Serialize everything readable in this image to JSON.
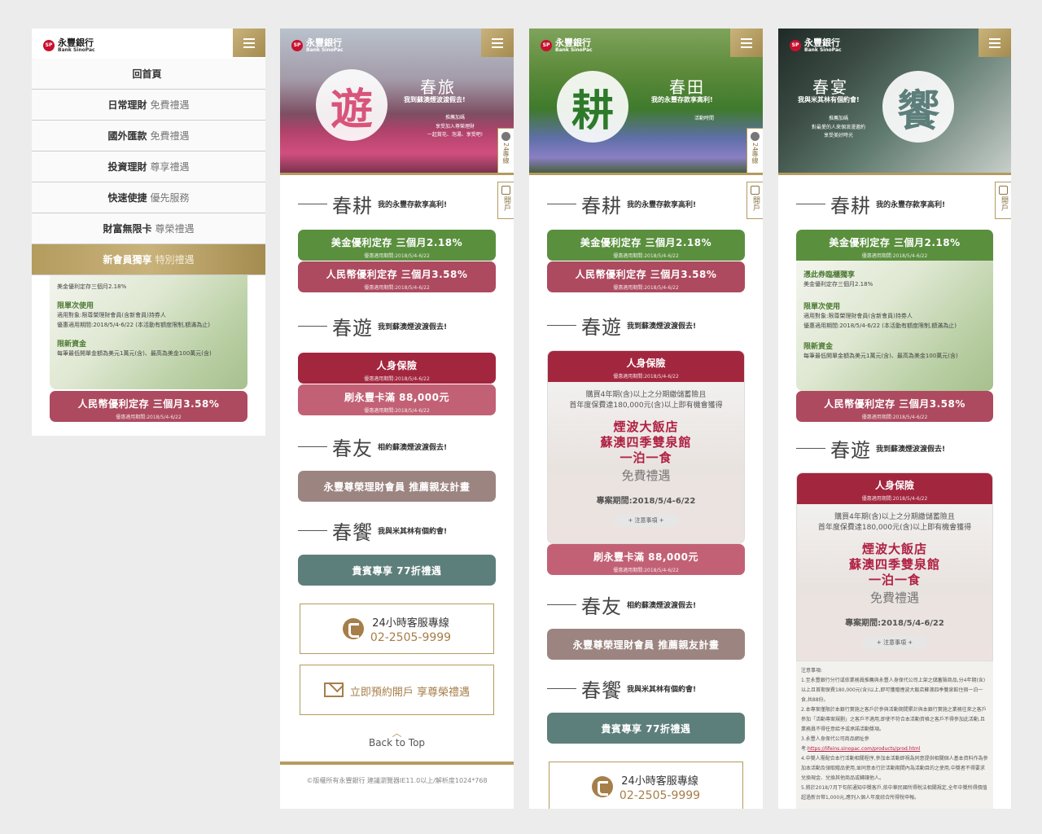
{
  "brand": {
    "cn": "永豐銀行",
    "en": "Bank SinoPac"
  },
  "menu": {
    "items": [
      {
        "bold": "回首頁",
        "light": ""
      },
      {
        "bold": "日常理財",
        "light": "免費禮遇"
      },
      {
        "bold": "國外匯款",
        "light": "免費禮遇"
      },
      {
        "bold": "投資理財",
        "light": "尊享禮遇"
      },
      {
        "bold": "快速使捷",
        "light": "優先服務"
      },
      {
        "bold": "財富無限卡",
        "light": "尊榮禮遇"
      },
      {
        "bold": "新會員獨享",
        "light": "特別禮遇"
      }
    ]
  },
  "side": {
    "hotline": "24專線",
    "open": "開戶"
  },
  "heroes": {
    "p2": {
      "char": "遊",
      "title": "春旅",
      "sub": "我到蘇澳煙波渡假去!",
      "small1": "推薦加碼",
      "small2": "享受加入尊榮理財\n一起賞花、泡湯、享受吧!"
    },
    "p3": {
      "char": "耕",
      "title": "春田",
      "sub": "我的永豐存款享高利!",
      "small1": "活動時間",
      "small2": ""
    },
    "p4": {
      "char": "饗",
      "title": "春宴",
      "sub": "我與米其林有個約會!",
      "small1": "推薦加碼",
      "small2": "對最愛的人來個浪漫邀約\n享受美好時光"
    }
  },
  "sections": {
    "geng": {
      "t": "春耕",
      "d": "我的永豐存款享高利!"
    },
    "you": {
      "t": "春遊",
      "d": "我到蘇澳煙波渡假去!"
    },
    "friend": {
      "t": "春友",
      "d": "相約蘇澳煙波渡假去!"
    },
    "feast": {
      "t": "春饗",
      "d": "我與米其林有個約會!"
    }
  },
  "offers": {
    "usd": {
      "m": "美金優利定存 三個月2.18%",
      "s": "優惠適用期間:2018/5/4-6/22"
    },
    "rmb": {
      "m": "人民幣優利定存 三個月3.58%",
      "s": "優惠適用期間:2018/5/4-6/22"
    },
    "life": {
      "m": "人身保險",
      "s": "優惠適用期間:2018/5/4-6/22"
    },
    "card": {
      "m": "刷永豐卡滿 88,000元",
      "s": "優惠適用期間:2018/5/4-6/22"
    },
    "member": {
      "m": "永豐尊榮理財會員 推薦親友計畫"
    },
    "vip": {
      "m": "貴賓專享 77折禮遇"
    }
  },
  "usd_detail": {
    "h1": "憑此券臨櫃獨享",
    "x1": "美金優利定存三個月2.18%",
    "h2": "限單次使用",
    "x2": "適用對象:限尊榮理財會員(含新會員)持券人",
    "x3": "優惠適用期間:2018/5/4-6/22 (本活動有額度限制,額滿為止)",
    "h3": "限新資金",
    "x4": "每筆最低開單金額為美元1萬元(含)、最高為美金100萬元(含)"
  },
  "insurance": {
    "p": "購買4年期(含)以上之分期繳儲蓄險且\n首年度保費達180,000元(含)以上即有機會獲得",
    "big": "煙波大飯店\n蘇澳四季雙泉館\n一泊一食",
    "free": "免費禮遇",
    "period": "專案期間:2018/5/4-6/22",
    "note": "+ 注意事項 +"
  },
  "service": {
    "a": "24小時客服專線",
    "b": "02-2505-9999",
    "apply": "立即預約開戶 享尊榮禮遇"
  },
  "backtop": "Back to Top",
  "copyright": "©版權所有永豐銀行 建議瀏覽器IE11.0以上/解析度1024*768",
  "notes": {
    "title": "注意事項:",
    "n1": "1.至永豐銀行分行或依業務員推薦與永豐人身保代公司上架之儲蓄險商品,分4年期(含)以上且首期保費180,000元(含)以上,即可獲贈煙波大飯店蘇澳四季雙泉館住宿一泊一食,共88份。",
    "n2": "2.本專案僅限於本銀行實施之客戶於參與活動期間累計與本銀行實施之業務往來之客戶參加「活動專案規劃」之客戶不適用,即使不符合本活動資格之客戶不得參加此活動,且業務員不得任意給予或承諾活動獎項。",
    "n3": "3.永豐人身保代公司商品網址參考:",
    "link": "https://lifeins.sinopac.com/products/prod.html",
    "n4": "4.中獎人需配合本行活動相關程序,參加本活動即視為同意提供相關個人基本資料作為參加本活動及領取贈品使用,並同意本行於活動期間內為活動目的之使用,中獎者不得要求兌換現金、兌換其他商品或轉讓他人。",
    "n5": "5.將於2018/7月下旬前通知中獎客戶,依中華民國所得稅法相關規定,全年中獎所得價值超過新台幣1,000元,應列入個人年度綜合所得稅申報。"
  },
  "colors": {
    "gold": "#b49b5e",
    "green": "#5a8f3e",
    "red": "#ad4a5f",
    "crimson": "#a3263f",
    "teal": "#5d7f7b",
    "taupe": "#9c8480"
  },
  "icons": [
    "menu-icon",
    "phone-icon",
    "mail-icon",
    "chevron-up-icon",
    "bank-logo"
  ]
}
